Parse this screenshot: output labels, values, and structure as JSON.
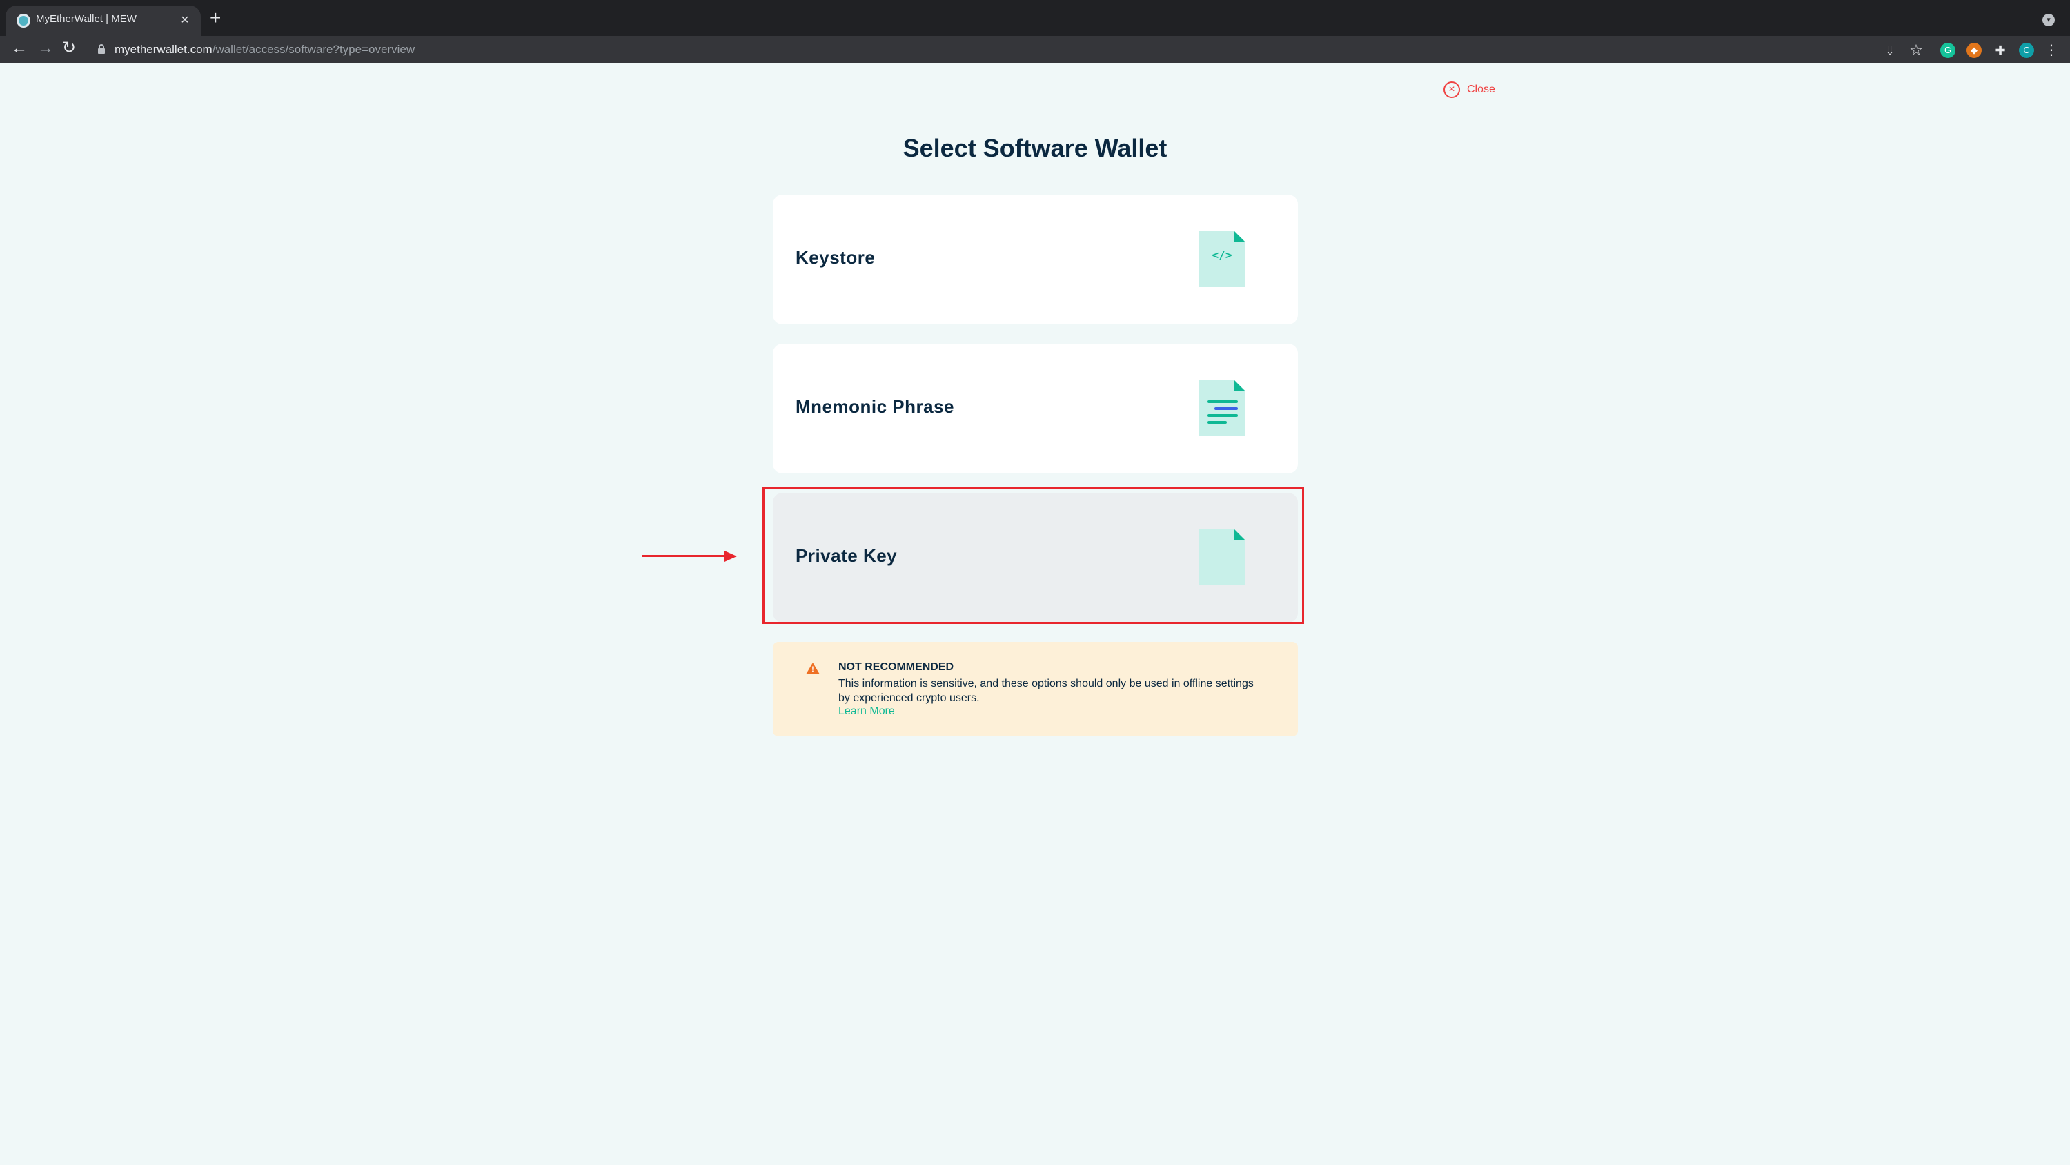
{
  "browser": {
    "tab_title": "MyEtherWallet | MEW",
    "tab_close_glyph": "×",
    "new_tab_glyph": "+",
    "url_host": "myetherwallet.com",
    "url_path": "/wallet/access/software?type=overview",
    "profile_initial": "C"
  },
  "page": {
    "close_label": "Close",
    "title": "Select Software Wallet",
    "wallet_options": [
      {
        "label": "Keystore",
        "icon": "code-file-icon"
      },
      {
        "label": "Mnemonic Phrase",
        "icon": "text-file-icon"
      },
      {
        "label": "Private Key",
        "icon": "key-file-icon"
      }
    ],
    "highlighted_option": "Private Key",
    "warning": {
      "title": "NOT RECOMMENDED",
      "body": "This information is sensitive, and these options should only be used in offline settings by experienced crypto users.",
      "link": "Learn More"
    }
  },
  "colors": {
    "accent": "#0fb894",
    "annotation_red": "#e8262d",
    "close_red": "#ef4444",
    "warning_bg": "#fdf0d8",
    "title_navy": "#0b2840"
  }
}
